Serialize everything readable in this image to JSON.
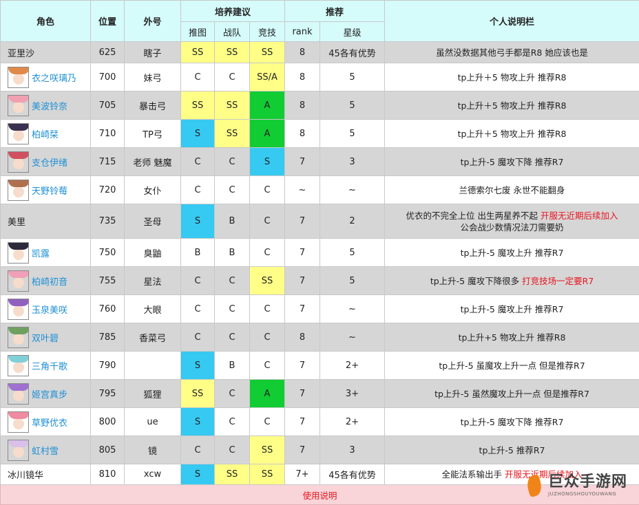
{
  "header": {
    "role": "角色",
    "position": "位置",
    "alias": "外号",
    "training": "培养建议",
    "recommend": "推荐",
    "note": "个人说明栏",
    "sub": [
      "推图",
      "战队",
      "竞技",
      "rank",
      "星级"
    ]
  },
  "rows": [
    {
      "name": "亚里沙",
      "avatar": false,
      "pos": "625",
      "alias": "瞎子",
      "push": "SS",
      "clan": "SS",
      "arena": "SS",
      "rank": "8",
      "star": "45各有优势",
      "note": "虽然没数据其他弓手都是R8 她应该也是",
      "note_red": "",
      "bg": "gray",
      "hair": "#c9a07a",
      "c_push": "y",
      "c_clan": "y",
      "c_arena": "y"
    },
    {
      "name": "衣之咲璃乃",
      "avatar": true,
      "pos": "700",
      "alias": "妹弓",
      "push": "C",
      "clan": "C",
      "arena": "SS/A",
      "rank": "8",
      "star": "5",
      "note": "tp上升＋5 物攻上升 推荐R8",
      "note_red": "",
      "bg": "white",
      "hair": "#e08a4a",
      "c_push": "",
      "c_clan": "",
      "c_arena": "y"
    },
    {
      "name": "美波铃奈",
      "avatar": true,
      "pos": "705",
      "alias": "暴击弓",
      "push": "SS",
      "clan": "SS",
      "arena": "A",
      "rank": "8",
      "star": "5",
      "note": "tp上升＋5 物攻上升 推荐R8",
      "note_red": "",
      "bg": "gray",
      "hair": "#f0a0b0",
      "c_push": "y",
      "c_clan": "y",
      "c_arena": "g"
    },
    {
      "name": "柏崎栞",
      "avatar": true,
      "pos": "710",
      "alias": "TP弓",
      "push": "S",
      "clan": "SS",
      "arena": "A",
      "rank": "8",
      "star": "5",
      "note": "tp上升＋5 物攻上升 推荐R8",
      "note_red": "",
      "bg": "white",
      "hair": "#3a3050",
      "c_push": "b",
      "c_clan": "y",
      "c_arena": "g"
    },
    {
      "name": "支仓伊绪",
      "avatar": true,
      "pos": "715",
      "alias": "老师 魅魔",
      "push": "C",
      "clan": "C",
      "arena": "S",
      "rank": "7",
      "star": "3",
      "note": "tp上升-5 魔攻下降 推荐R7",
      "note_red": "",
      "bg": "gray",
      "hair": "#d05060",
      "c_push": "",
      "c_clan": "",
      "c_arena": "b"
    },
    {
      "name": "天野铃莓",
      "avatar": true,
      "pos": "720",
      "alias": "女仆",
      "push": "C",
      "clan": "C",
      "arena": "C",
      "rank": "~",
      "star": "~",
      "note": "兰德索尔七废 永世不能翻身",
      "note_red": "",
      "bg": "white",
      "hair": "#b07050",
      "c_push": "",
      "c_clan": "",
      "c_arena": ""
    },
    {
      "name": "美里",
      "avatar": false,
      "pos": "735",
      "alias": "圣母",
      "push": "S",
      "clan": "B",
      "arena": "C",
      "rank": "7",
      "star": "2",
      "note": "优衣的不完全上位 出生两星养不起 ",
      "note_red": "开服无近期后续加入",
      "note2": "公会战少数情况法刀需要奶",
      "bg": "gray",
      "hair": "#888",
      "c_push": "b",
      "c_clan": "",
      "c_arena": ""
    },
    {
      "name": "凯露",
      "avatar": true,
      "pos": "750",
      "alias": "臭鼬",
      "push": "B",
      "clan": "B",
      "arena": "C",
      "rank": "7",
      "star": "5",
      "note": "tp上升-5 魔攻上升 推荐R7",
      "note_red": "",
      "bg": "white",
      "hair": "#2a2a3a",
      "c_push": "",
      "c_clan": "",
      "c_arena": ""
    },
    {
      "name": "柏崎初音",
      "avatar": true,
      "pos": "755",
      "alias": "星法",
      "push": "C",
      "clan": "C",
      "arena": "SS",
      "rank": "7",
      "star": "5",
      "note": "tp上升-5 魔攻下降很多 ",
      "note_red": "打竞技场一定要R7",
      "bg": "gray",
      "hair": "#f0a0b8",
      "c_push": "",
      "c_clan": "",
      "c_arena": "y"
    },
    {
      "name": "玉泉美咲",
      "avatar": true,
      "pos": "760",
      "alias": "大眼",
      "push": "C",
      "clan": "C",
      "arena": "C",
      "rank": "7",
      "star": "~",
      "note": "tp上升-5 魔攻上升 推荐R7",
      "note_red": "",
      "bg": "white",
      "hair": "#9060c0",
      "c_push": "",
      "c_clan": "",
      "c_arena": ""
    },
    {
      "name": "双叶碧",
      "avatar": true,
      "pos": "785",
      "alias": "香菜弓",
      "push": "C",
      "clan": "C",
      "arena": "C",
      "rank": "8",
      "star": "~",
      "note": "tp上升+5 物攻上升 推荐R8",
      "note_red": "",
      "bg": "gray",
      "hair": "#70a060",
      "c_push": "",
      "c_clan": "",
      "c_arena": ""
    },
    {
      "name": "三角千歌",
      "avatar": true,
      "pos": "790",
      "alias": "",
      "push": "S",
      "clan": "B",
      "arena": "C",
      "rank": "7",
      "star": "2+",
      "note": "tp上升-5 虽魔攻上升一点 但是推荐R7",
      "note_red": "",
      "bg": "white",
      "hair": "#80d0d8",
      "c_push": "b",
      "c_clan": "",
      "c_arena": ""
    },
    {
      "name": "姬宫真步",
      "avatar": true,
      "pos": "795",
      "alias": "狐狸",
      "push": "SS",
      "clan": "C",
      "arena": "A",
      "rank": "7",
      "star": "3+",
      "note": "tp上升-5 虽然魔攻上升一点 但是推荐R7",
      "note_red": "",
      "bg": "gray",
      "hair": "#a070d0",
      "c_push": "y",
      "c_clan": "",
      "c_arena": "g"
    },
    {
      "name": "草野优衣",
      "avatar": true,
      "pos": "800",
      "alias": "ue",
      "push": "S",
      "clan": "C",
      "arena": "C",
      "rank": "7",
      "star": "2+",
      "note": "tp上升-5 魔攻下降 推荐R7",
      "note_red": "",
      "bg": "white",
      "hair": "#f08aa0",
      "c_push": "b",
      "c_clan": "",
      "c_arena": ""
    },
    {
      "name": "虹村雪",
      "avatar": true,
      "pos": "805",
      "alias": "镜",
      "push": "C",
      "clan": "C",
      "arena": "SS",
      "rank": "7",
      "star": "3",
      "note": "tp上升-5 推荐R7",
      "note_red": "",
      "bg": "gray",
      "hair": "#d8c0e8",
      "c_push": "",
      "c_clan": "",
      "c_arena": "y"
    },
    {
      "name": "冰川镜华",
      "avatar": false,
      "pos": "810",
      "alias": "xcw",
      "push": "S",
      "clan": "SS",
      "arena": "SS",
      "rank": "7+",
      "star": "45各有优势",
      "note": "全能法系输出手 ",
      "note_red": "开服无近期后续加入",
      "bg": "white",
      "hair": "#888",
      "c_push": "b",
      "c_clan": "y",
      "c_arena": "y"
    }
  ],
  "footer": "使用说明",
  "watermark": {
    "cn": "巨众手游网",
    "en": "JUZHONGSHOUYOUWANG"
  },
  "colors": {
    "header_bg": "#d5fbfb",
    "gray_row": "#d6d6d6",
    "yellow": "#ffff88",
    "blue": "#36c9f2",
    "green": "#11cc33",
    "link": "#1e90d6",
    "red": "#e8141e",
    "footer_bg": "#f9d4d8"
  }
}
